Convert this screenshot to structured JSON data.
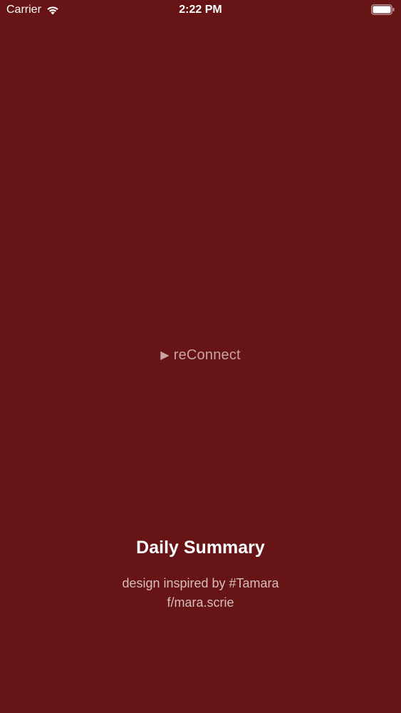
{
  "status_bar": {
    "carrier": "Carrier",
    "time": "2:22 PM",
    "wifi_icon": "wifi-icon",
    "battery_icon": "battery-icon"
  },
  "main": {
    "connect_icon": "play-icon",
    "connect_label": "reConnect",
    "title": "Daily Summary",
    "credit_line_1": "design inspired by #Tamara",
    "credit_line_2": "f/mara.scrie"
  },
  "colors": {
    "background": "#661415",
    "primary_text": "#ffffff",
    "muted_text": "#c9a3a3"
  }
}
